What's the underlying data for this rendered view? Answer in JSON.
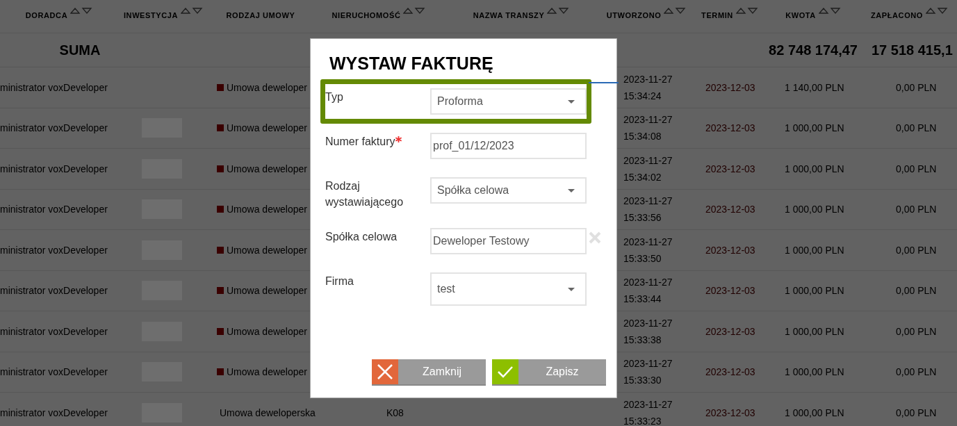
{
  "table": {
    "columns": [
      {
        "label": "DORADCA",
        "sortable": true
      },
      {
        "label": "INWESTYCJA",
        "sortable": true
      },
      {
        "label": "RODZAJ UMOWY",
        "sortable": false
      },
      {
        "label": "NIERUCHOMOŚĆ",
        "sortable": true
      },
      {
        "label": "NAZWA TRANSZY",
        "sortable": true
      },
      {
        "label": "UTWORZONO",
        "sortable": true
      },
      {
        "label": "TERMIN",
        "sortable": true
      },
      {
        "label": "KWOTA",
        "sortable": true
      },
      {
        "label": "ZAPŁACONO",
        "sortable": true
      }
    ],
    "sum_row": {
      "label": "SUMA",
      "kwota": "82 748 174,47",
      "zaplacono": "17 518 415,1"
    },
    "rows": [
      {
        "doradca": "ministrator voxDeveloper",
        "redacted": false,
        "umowa": "Umowa deweloper",
        "nieruchomosc": "",
        "date": "2023-11-27",
        "time": "15:34:24",
        "termin": "2023-12-03",
        "kwota": "1 140,00 PLN",
        "zaplacono": "0,00 PLN"
      },
      {
        "doradca": "ministrator voxDeveloper",
        "redacted": true,
        "umowa": "Umowa deweloper",
        "nieruchomosc": "",
        "date": "2023-11-27",
        "time": "15:34:08",
        "termin": "2023-12-03",
        "kwota": "1 000,00 PLN",
        "zaplacono": "0,00 PLN"
      },
      {
        "doradca": "ministrator voxDeveloper",
        "redacted": true,
        "umowa": "Umowa deweloper",
        "nieruchomosc": "",
        "date": "2023-11-27",
        "time": "15:34:02",
        "termin": "2023-12-03",
        "kwota": "1 000,00 PLN",
        "zaplacono": "0,00 PLN"
      },
      {
        "doradca": "ministrator voxDeveloper",
        "redacted": true,
        "umowa": "Umowa deweloper",
        "nieruchomosc": "",
        "date": "2023-11-27",
        "time": "15:33:56",
        "termin": "2023-12-03",
        "kwota": "1 000,00 PLN",
        "zaplacono": "0,00 PLN"
      },
      {
        "doradca": "ministrator voxDeveloper",
        "redacted": true,
        "umowa": "Umowa deweloper",
        "nieruchomosc": "",
        "date": "2023-11-27",
        "time": "15:33:50",
        "termin": "2023-12-03",
        "kwota": "1 000,00 PLN",
        "zaplacono": "0,00 PLN"
      },
      {
        "doradca": "ministrator voxDeveloper",
        "redacted": true,
        "umowa": "Umowa deweloper",
        "nieruchomosc": "",
        "date": "2023-11-27",
        "time": "15:33:44",
        "termin": "2023-12-03",
        "kwota": "1 000,00 PLN",
        "zaplacono": "0,00 PLN"
      },
      {
        "doradca": "ministrator voxDeveloper",
        "redacted": true,
        "umowa": "Umowa deweloper",
        "nieruchomosc": "",
        "date": "2023-11-27",
        "time": "15:33:38",
        "termin": "2023-12-03",
        "kwota": "1 000,00 PLN",
        "zaplacono": "0,00 PLN"
      },
      {
        "doradca": "ministrator voxDeveloper",
        "redacted": true,
        "umowa": "Umowa deweloper",
        "nieruchomosc": "",
        "date": "2023-11-27",
        "time": "15:33:30",
        "termin": "2023-12-03",
        "kwota": "1 000,00 PLN",
        "zaplacono": "0,00 PLN"
      },
      {
        "doradca": "ministrator voxDeveloper",
        "redacted": true,
        "umowa": "Umowa deweloperska",
        "nieruchomosc": "K08",
        "date": "2023-11-27",
        "time": "15:33:23",
        "termin": "2023-12-03",
        "kwota": "1 000,00 PLN",
        "zaplacono": "0,00 PLN"
      }
    ]
  },
  "modal": {
    "title": "WYSTAW FAKTURĘ",
    "fields": [
      {
        "kind": "select",
        "label": "Typ",
        "value": "Proforma",
        "highlighted": true,
        "required": false
      },
      {
        "kind": "text",
        "label": "Numer faktury",
        "value": "prof_01/12/2023",
        "highlighted": false,
        "required": true
      },
      {
        "kind": "select",
        "label": "Rodzaj wystawiającego",
        "value": "Spółka celowa",
        "highlighted": false,
        "required": false
      },
      {
        "kind": "clearable",
        "label": "Spółka celowa",
        "value": "Deweloper Testowy",
        "highlighted": false,
        "required": false
      },
      {
        "kind": "select",
        "label": "Firma",
        "value": "test",
        "highlighted": false,
        "required": false
      }
    ],
    "buttons": [
      {
        "kind": "close",
        "label": "Zamknij"
      },
      {
        "kind": "save",
        "label": "Zapisz"
      }
    ]
  }
}
